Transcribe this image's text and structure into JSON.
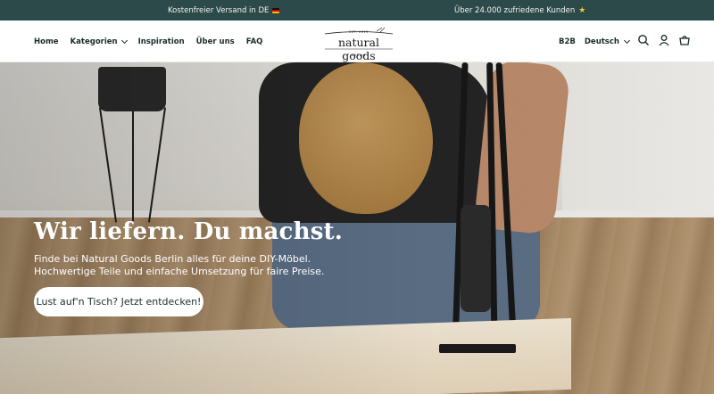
{
  "announcement": {
    "left_text": "Kostenfreier Versand in DE",
    "right_text": "Über 24.000 zufriedene Kunden",
    "left_icon": "german-flag-icon",
    "right_icon": "star-icon"
  },
  "header": {
    "nav": [
      {
        "label": "Home"
      },
      {
        "label": "Kategorien"
      },
      {
        "label": "Inspiration"
      },
      {
        "label": "Über uns"
      },
      {
        "label": "FAQ"
      }
    ],
    "logo": {
      "tagline": "EST. 2015",
      "name": "natural goods",
      "city": "BERLIN"
    },
    "b2b_label": "B2B",
    "language": "Deutsch",
    "icons": [
      "search-icon",
      "account-icon",
      "cart-icon"
    ]
  },
  "hero": {
    "title": "Wir liefern. Du machst.",
    "subtitle_line1": "Finde bei Natural Goods Berlin alles für deine DIY-Möbel.",
    "subtitle_line2": "Hochwertige Teile und einfache Umsetzung für faire Preise.",
    "cta_label": "Lust auf'n Tisch? Jetzt entdecken!"
  },
  "colors": {
    "announcement_bg": "#2c4a49",
    "text_dark": "#1b2a2b",
    "star": "#f5c43a"
  }
}
